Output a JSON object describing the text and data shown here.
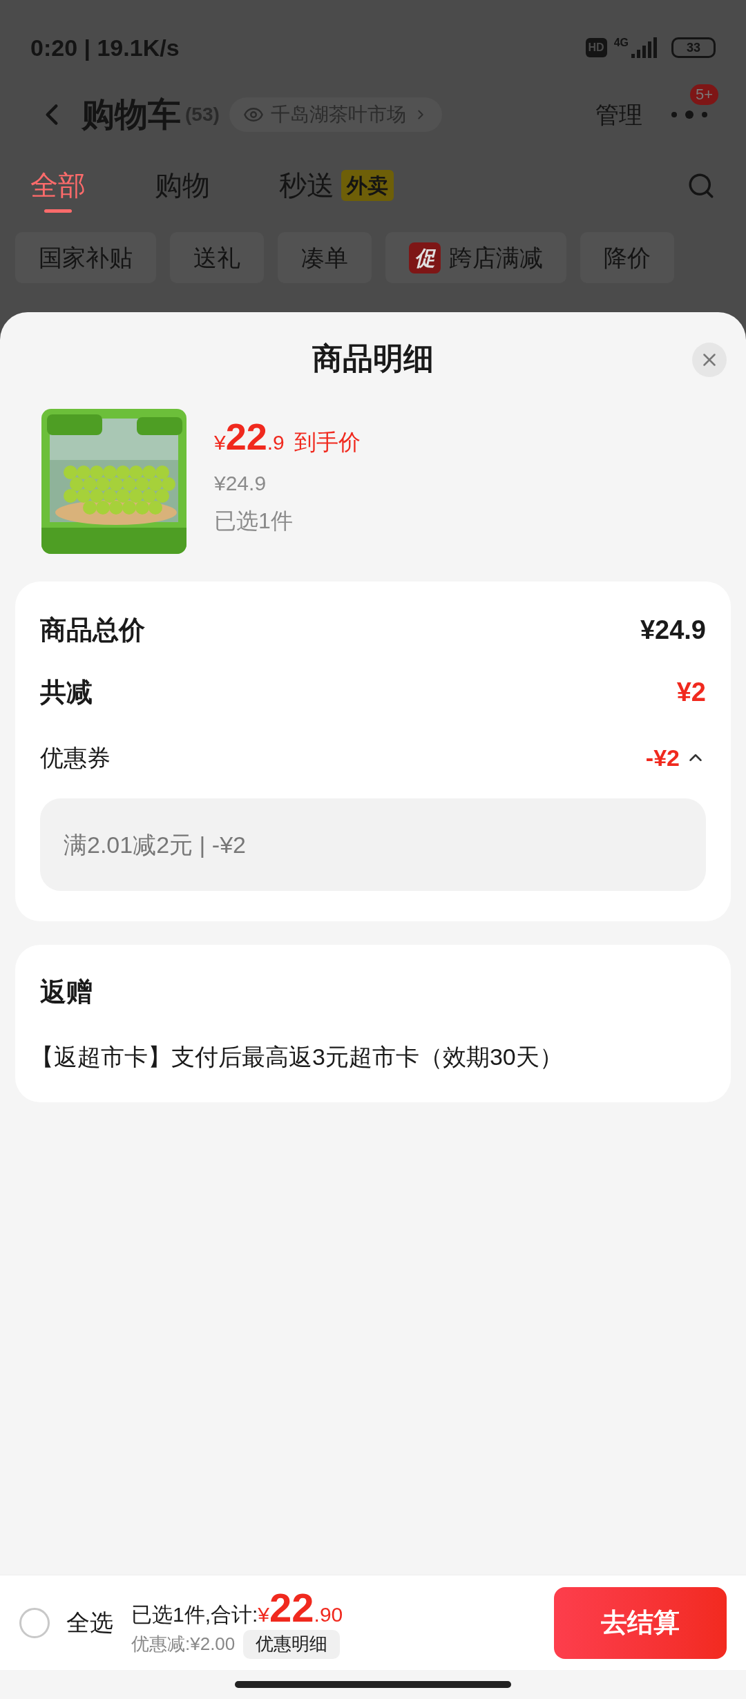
{
  "status_bar": {
    "time": "0:20 | 19.1K/s",
    "hd": "HD",
    "network": "4G",
    "battery": "33"
  },
  "header": {
    "title": "购物车",
    "count": "(53)",
    "store": "千岛湖茶叶市场",
    "manage": "管理",
    "badge": "5+"
  },
  "tabs": [
    {
      "label": "全部",
      "selected": true
    },
    {
      "label": "购物",
      "selected": false
    },
    {
      "label": "秒送",
      "selected": false,
      "tag": "外卖"
    }
  ],
  "filters": [
    {
      "label": "国家补贴"
    },
    {
      "label": "送礼"
    },
    {
      "label": "凑单"
    },
    {
      "label": "跨店满减",
      "tag": "促"
    },
    {
      "label": "降价"
    }
  ],
  "sheet": {
    "title": "商品明细",
    "product": {
      "currency": "¥",
      "price_int": "22",
      "price_dec": ".9",
      "price_label": "到手价",
      "original_price": "¥24.9",
      "selected_count": "已选1件"
    },
    "summary": {
      "total": {
        "label": "商品总价",
        "value": "¥24.9"
      },
      "reduction": {
        "label": "共减",
        "value": "¥2"
      },
      "coupon": {
        "label": "优惠券",
        "value": "-¥2",
        "expanded": true
      },
      "coupon_detail": "满2.01减2元 | -¥2"
    },
    "gift": {
      "title": "返赠",
      "text": "【返超市卡】支付后最高返3元超市卡（效期30天）"
    }
  },
  "footer": {
    "select_all": {
      "label": "全选",
      "checked": false
    },
    "summary_label": "已选1件,合计:",
    "currency": "¥",
    "total_int": "22",
    "total_dec": ".90",
    "discount": "优惠减:¥2.00",
    "detail_button": "优惠明细",
    "checkout": "去结算"
  }
}
